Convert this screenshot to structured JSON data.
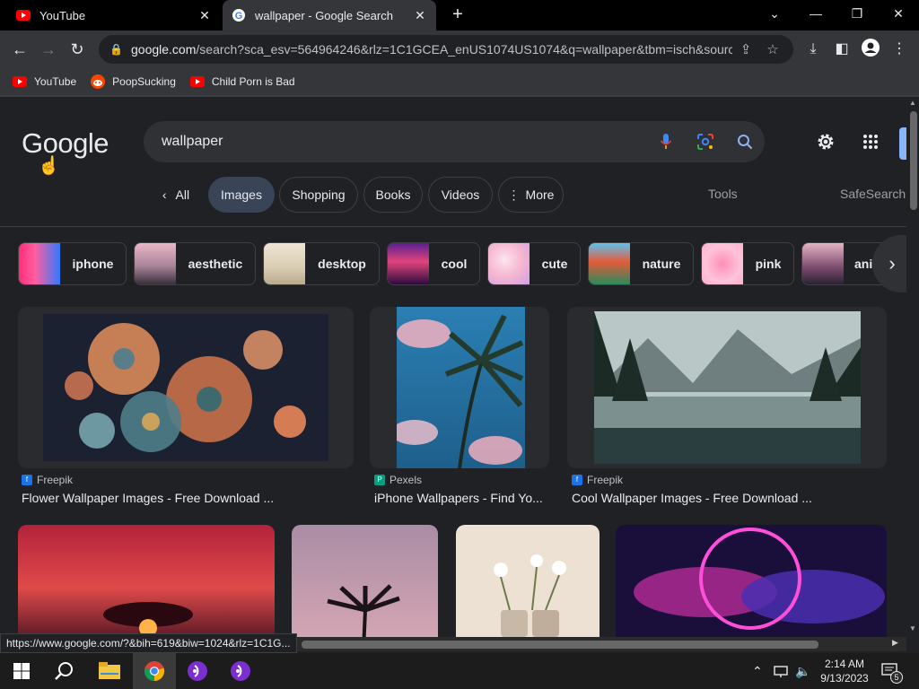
{
  "browser": {
    "tabs": [
      {
        "title": "YouTube",
        "icon": "youtube-icon",
        "active": false
      },
      {
        "title": "wallpaper - Google Search",
        "icon": "google-icon",
        "active": true
      }
    ],
    "url_host": "google.com",
    "url_rest": "/search?sca_esv=564964246&rlz=1C1GCEA_enUS1074US1074&q=wallpaper&tbm=isch&sourc...",
    "bookmarks": [
      {
        "label": "YouTube",
        "icon": "youtube-icon"
      },
      {
        "label": "PoopSucking",
        "icon": "reddit-icon"
      },
      {
        "label": "Child Porn is Bad",
        "icon": "youtube-icon"
      }
    ],
    "status_url": "https://www.google.com/?&bih=619&biw=1024&rlz=1C1G..."
  },
  "google": {
    "logo": "Google",
    "query": "wallpaper",
    "filters": [
      {
        "label": "All",
        "selected": false,
        "prefix": "‹"
      },
      {
        "label": "Images",
        "selected": true
      },
      {
        "label": "Shopping",
        "selected": false
      },
      {
        "label": "Books",
        "selected": false
      },
      {
        "label": "Videos",
        "selected": false
      },
      {
        "label": "More",
        "selected": false,
        "prefix": "⋮"
      }
    ],
    "tools": "Tools",
    "safesearch": "SafeSearch",
    "related": [
      "iphone",
      "aesthetic",
      "desktop",
      "cool",
      "cute",
      "nature",
      "pink",
      "ani"
    ],
    "results": [
      {
        "source": "Freepik",
        "title": "Flower Wallpaper Images - Free Download ..."
      },
      {
        "source": "Pexels",
        "title": "iPhone Wallpapers - Find Yo..."
      },
      {
        "source": "Freepik",
        "title": "Cool Wallpaper Images - Free Download ..."
      }
    ]
  },
  "taskbar": {
    "time": "2:14 AM",
    "date": "9/13/2023",
    "notifications": "5"
  },
  "colors": {
    "background": "#202124",
    "accent": "#8ab4f8",
    "selected_chip": "#394457"
  }
}
